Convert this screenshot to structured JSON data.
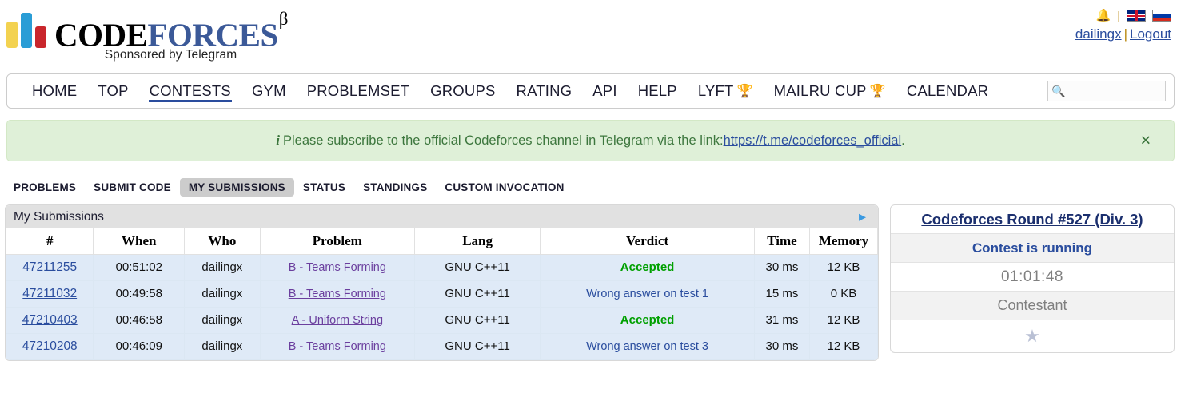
{
  "header": {
    "logo": {
      "code": "CODE",
      "forces": "FORCES",
      "beta": "β",
      "sponsor": "Sponsored by Telegram"
    },
    "bell_icon": "bell-icon",
    "separator": "|",
    "flag_en": "uk-flag-icon",
    "flag_ru": "russia-flag-icon",
    "username": "dailingx",
    "logout": "Logout",
    "pipe": "|"
  },
  "nav": {
    "items": [
      {
        "label": "HOME",
        "active": false,
        "trophy": false
      },
      {
        "label": "TOP",
        "active": false,
        "trophy": false
      },
      {
        "label": "CONTESTS",
        "active": true,
        "trophy": false
      },
      {
        "label": "GYM",
        "active": false,
        "trophy": false
      },
      {
        "label": "PROBLEMSET",
        "active": false,
        "trophy": false
      },
      {
        "label": "GROUPS",
        "active": false,
        "trophy": false
      },
      {
        "label": "RATING",
        "active": false,
        "trophy": false
      },
      {
        "label": "API",
        "active": false,
        "trophy": false
      },
      {
        "label": "HELP",
        "active": false,
        "trophy": false
      },
      {
        "label": "LYFT",
        "active": false,
        "trophy": true
      },
      {
        "label": "MAILRU CUP",
        "active": false,
        "trophy": true
      },
      {
        "label": "CALENDAR",
        "active": false,
        "trophy": false
      }
    ],
    "trophy_glyph": "🏆",
    "search": {
      "icon": "search-icon",
      "placeholder": "",
      "value": ""
    }
  },
  "banner": {
    "info_icon": "i",
    "text_before": "Please subscribe to the official Codeforces channel in Telegram via the link: ",
    "link": "https://t.me/codeforces_official",
    "text_after": ".",
    "close": "✕"
  },
  "subtabs": [
    {
      "label": "PROBLEMS",
      "active": false
    },
    {
      "label": "SUBMIT CODE",
      "active": false
    },
    {
      "label": "MY SUBMISSIONS",
      "active": true
    },
    {
      "label": "STATUS",
      "active": false
    },
    {
      "label": "STANDINGS",
      "active": false
    },
    {
      "label": "CUSTOM INVOCATION",
      "active": false
    }
  ],
  "table": {
    "caption": "My Submissions",
    "arrow_icon": "►",
    "columns": [
      "#",
      "When",
      "Who",
      "Problem",
      "Lang",
      "Verdict",
      "Time",
      "Memory"
    ],
    "rows": [
      {
        "id": "47211255",
        "when": "00:51:02",
        "who": "dailingx",
        "problem": "B - Teams Forming",
        "lang": "GNU C++11",
        "verdict": "Accepted",
        "verdict_type": "accepted",
        "time": "30 ms",
        "memory": "12 KB"
      },
      {
        "id": "47211032",
        "when": "00:49:58",
        "who": "dailingx",
        "problem": "B - Teams Forming",
        "lang": "GNU C++11",
        "verdict": "Wrong answer on test 1",
        "verdict_type": "wrong",
        "time": "15 ms",
        "memory": "0 KB"
      },
      {
        "id": "47210403",
        "when": "00:46:58",
        "who": "dailingx",
        "problem": "A - Uniform String",
        "lang": "GNU C++11",
        "verdict": "Accepted",
        "verdict_type": "accepted",
        "time": "31 ms",
        "memory": "12 KB"
      },
      {
        "id": "47210208",
        "when": "00:46:09",
        "who": "dailingx",
        "problem": "B - Teams Forming",
        "lang": "GNU C++11",
        "verdict": "Wrong answer on test 3",
        "verdict_type": "wrong",
        "time": "30 ms",
        "memory": "12 KB"
      }
    ]
  },
  "sidebar": {
    "contest_title": "Codeforces Round #527 (Div. 3)",
    "status": "Contest is running",
    "timer": "01:01:48",
    "role": "Contestant",
    "star_icon": "★"
  },
  "colors": {
    "accent_blue": "#2a4d9e",
    "logo_blue": "#3b5998",
    "accepted_green": "#00a000",
    "banner_bg": "#dff0d8",
    "banner_text": "#3c763d",
    "row_bg": "#dfeaf7",
    "problem_link": "#6b3f9e"
  }
}
